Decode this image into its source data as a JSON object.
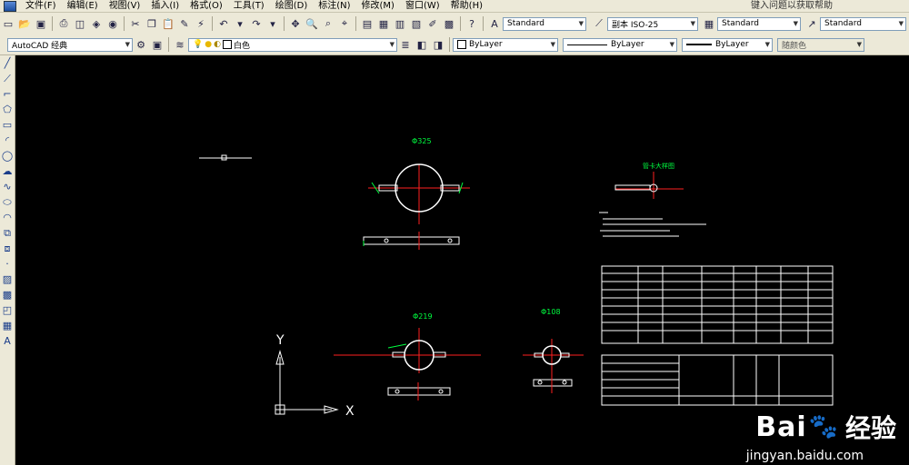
{
  "menubar": {
    "items": [
      "文件(F)",
      "编辑(E)",
      "视图(V)",
      "插入(I)",
      "格式(O)",
      "工具(T)",
      "绘图(D)",
      "标注(N)",
      "修改(M)",
      "窗口(W)",
      "帮助(H)"
    ],
    "help_search": "键入问题以获取帮助"
  },
  "toolbar1": {
    "text_style": "Standard",
    "dim_style": "副本 ISO-25",
    "table_style": "Standard",
    "multileader_style": "Standard"
  },
  "toolbar2": {
    "workspace": "AutoCAD 经典",
    "layer": "白色",
    "color": "ByLayer",
    "linetype": "ByLayer",
    "lineweight": "ByLayer",
    "plot_style": "随颜色"
  },
  "drawing": {
    "labels": {
      "pipe_325": "Φ325",
      "pipe_219": "Φ219",
      "pipe_108": "Φ108",
      "detail_title": "管卡大样图",
      "ucs_y": "Y",
      "ucs_x": "X"
    },
    "colors": {
      "line": "#ffffff",
      "center": "#ff2020",
      "dim": "#00ff40",
      "pipe": "#ffffff"
    }
  },
  "watermark": {
    "logo": "Bai",
    "brand": "经验",
    "url": "jingyan.baidu.com"
  }
}
